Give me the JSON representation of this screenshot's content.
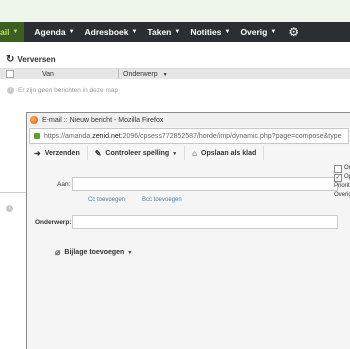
{
  "nav": {
    "mail_label": "ail",
    "items": [
      {
        "label": "Agenda"
      },
      {
        "label": "Adresboek"
      },
      {
        "label": "Taken"
      },
      {
        "label": "Notities"
      },
      {
        "label": "Overig"
      }
    ],
    "settings_icon": "gear-icon"
  },
  "toolbar": {
    "refresh_label": "Verversen",
    "refresh_icon": "refresh-icon"
  },
  "list": {
    "columns": {
      "from": "Van",
      "subject": "Onderwerp"
    },
    "empty_message": "Er zijn geen berichten in deze map"
  },
  "popup": {
    "title": "E-mail :: Nieuw bericht - Mozilla Firefox",
    "url_prefix": "https://amanda.",
    "url_domain": "zenid.net",
    "url_rest": ":2096/cpsess772852587/horde/imp/dynamic.php?page=compose&type",
    "buttons": {
      "send": "Verzenden",
      "spellcheck": "Controleer spelling",
      "save_draft": "Opslaan als klad"
    },
    "form": {
      "to_label": "Aan:",
      "cc_link": "Cc toevoegen",
      "bcc_link": "Bcc toevoegen",
      "subject_label": "Onderwerp:",
      "attach_label": "Bijlage toevoegen"
    },
    "options": [
      {
        "label": "Or",
        "checked": false
      },
      {
        "label": "Op",
        "checked": true
      },
      {
        "label": "Priorit",
        "checked": null
      },
      {
        "label": "Overig",
        "checked": null
      }
    ]
  }
}
